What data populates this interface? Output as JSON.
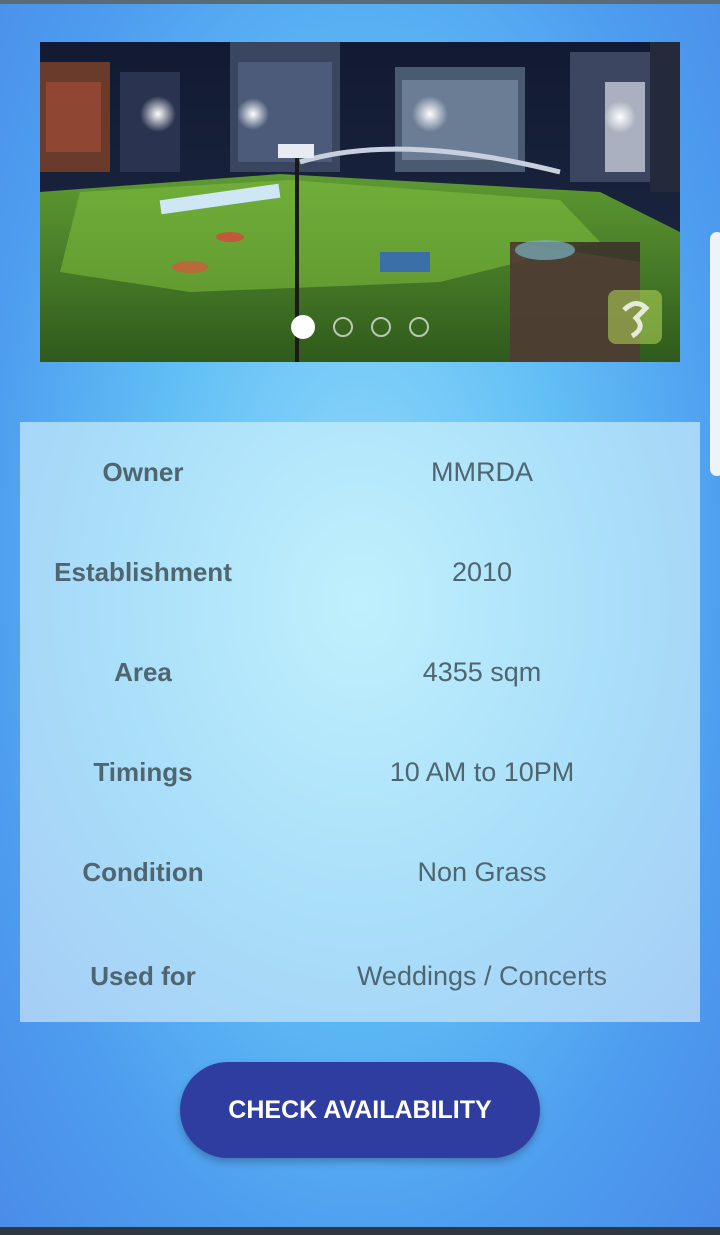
{
  "carousel": {
    "slide_count": 4,
    "active_index": 0,
    "image_description_icon": "stadium-photo"
  },
  "details": [
    {
      "label": "Owner",
      "value": "MMRDA"
    },
    {
      "label": "Establishment",
      "value": "2010"
    },
    {
      "label": "Area",
      "value": "4355 sqm"
    },
    {
      "label": "Timings",
      "value": "10 AM to 10PM"
    },
    {
      "label": "Condition",
      "value": "Non Grass"
    },
    {
      "label": "Used for",
      "value": "Weddings / Concerts"
    }
  ],
  "actions": {
    "check_availability": "CHECK AVAILABILITY"
  },
  "colors": {
    "button": "#2f3da0",
    "text": "#4f6570",
    "panel": "#b4e6fb"
  }
}
